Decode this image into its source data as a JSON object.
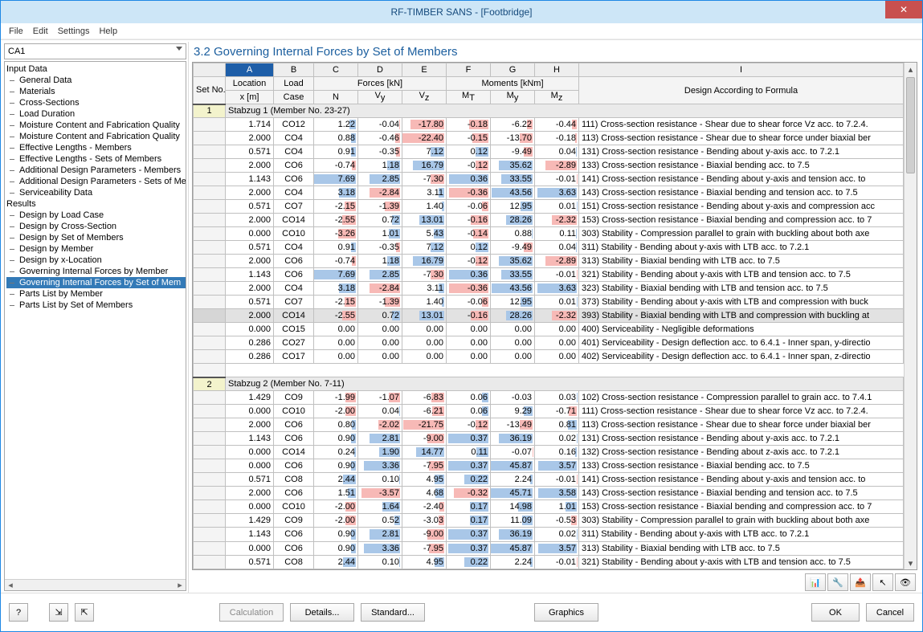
{
  "window": {
    "title": "RF-TIMBER SANS - [Footbridge]"
  },
  "menubar": {
    "file": "File",
    "edit": "Edit",
    "settings": "Settings",
    "help": "Help"
  },
  "left": {
    "combo": "CA1",
    "root1": "Input Data",
    "items1": [
      "General Data",
      "Materials",
      "Cross-Sections",
      "Load Duration",
      "Moisture Content and Fabrication Quality",
      "Moisture Content and Fabrication Quality",
      "Effective Lengths - Members",
      "Effective Lengths - Sets of Members",
      "Additional Design Parameters - Members",
      "Additional Design Parameters - Sets of Me",
      "Serviceability Data"
    ],
    "root2": "Results",
    "items2": [
      "Design by Load Case",
      "Design by Cross-Section",
      "Design by Set of Members",
      "Design by Member",
      "Design by x-Location",
      "Governing Internal Forces by Member",
      "Governing Internal Forces by Set of Mem",
      "Parts List by Member",
      "Parts List by Set of Members"
    ],
    "selectedIndex2": 6
  },
  "main": {
    "title": "3.2  Governing Internal Forces by Set of Members",
    "colLetters": [
      "A",
      "B",
      "C",
      "D",
      "E",
      "F",
      "G",
      "H",
      "I"
    ],
    "groupHeads": {
      "set": "Set\nNo.",
      "location": "Location",
      "load": "Load",
      "forces": "Forces [kN]",
      "moments": "Moments [kNm]",
      "design": "Design According to Formula",
      "x": "x [m]",
      "case": "Case",
      "N": "N",
      "Vy": "V_y",
      "Vz": "V_z",
      "MT": "M_T",
      "My": "M_y",
      "Mz": "M_z"
    },
    "groups": [
      {
        "setNo": "1",
        "label": "Stabzug 1 (Member No. 23-27)",
        "selectedRow": 14,
        "rows": [
          {
            "x": "1.714",
            "lc": "CO12",
            "N": "1.22",
            "Vy": "-0.04",
            "Vz": "-17.80",
            "MT": "-0.18",
            "My": "-6.22",
            "Mz": "-0.44",
            "d": "111) Cross-section resistance - Shear due to shear force Vz acc. to 7.2.4."
          },
          {
            "x": "2.000",
            "lc": "CO4",
            "N": "0.88",
            "Vy": "-0.46",
            "Vz": "-22.40",
            "MT": "-0.15",
            "My": "-13.70",
            "Mz": "-0.18",
            "d": "113) Cross-section resistance - Shear due to shear force under biaxial ber"
          },
          {
            "x": "0.571",
            "lc": "CO4",
            "N": "0.91",
            "Vy": "-0.35",
            "Vz": "7.12",
            "MT": "0.12",
            "My": "-9.49",
            "Mz": "0.04",
            "d": "131) Cross-section resistance - Bending about y-axis acc. to 7.2.1"
          },
          {
            "x": "2.000",
            "lc": "CO6",
            "N": "-0.74",
            "Vy": "1.18",
            "Vz": "16.79",
            "MT": "-0.12",
            "My": "35.62",
            "Mz": "-2.89",
            "d": "133) Cross-section resistance - Biaxial bending acc. to 7.5"
          },
          {
            "x": "1.143",
            "lc": "CO6",
            "N": "7.69",
            "Vy": "2.85",
            "Vz": "-7.30",
            "MT": "0.36",
            "My": "33.55",
            "Mz": "-0.01",
            "d": "141) Cross-section resistance - Bending about y-axis and tension acc. to"
          },
          {
            "x": "2.000",
            "lc": "CO4",
            "N": "3.18",
            "Vy": "-2.84",
            "Vz": "3.11",
            "MT": "-0.36",
            "My": "43.56",
            "Mz": "3.63",
            "d": "143) Cross-section resistance - Biaxial bending and tension acc. to 7.5"
          },
          {
            "x": "0.571",
            "lc": "CO7",
            "N": "-2.15",
            "Vy": "-1.39",
            "Vz": "1.40",
            "MT": "-0.06",
            "My": "12.95",
            "Mz": "0.01",
            "d": "151) Cross-section resistance - Bending about y-axis and compression acc"
          },
          {
            "x": "2.000",
            "lc": "CO14",
            "N": "-2.55",
            "Vy": "0.72",
            "Vz": "13.01",
            "MT": "-0.16",
            "My": "28.26",
            "Mz": "-2.32",
            "d": "153) Cross-section resistance - Biaxial bending and compression acc. to 7"
          },
          {
            "x": "0.000",
            "lc": "CO10",
            "N": "-3.26",
            "Vy": "1.01",
            "Vz": "5.43",
            "MT": "-0.14",
            "My": "0.88",
            "Mz": "0.11",
            "d": "303) Stability - Compression parallel to grain with buckling about both axe"
          },
          {
            "x": "0.571",
            "lc": "CO4",
            "N": "0.91",
            "Vy": "-0.35",
            "Vz": "7.12",
            "MT": "0.12",
            "My": "-9.49",
            "Mz": "0.04",
            "d": "311) Stability - Bending about y-axis with LTB acc. to 7.2.1"
          },
          {
            "x": "2.000",
            "lc": "CO6",
            "N": "-0.74",
            "Vy": "1.18",
            "Vz": "16.79",
            "MT": "-0.12",
            "My": "35.62",
            "Mz": "-2.89",
            "d": "313) Stability - Biaxial bending with LTB acc. to 7.5"
          },
          {
            "x": "1.143",
            "lc": "CO6",
            "N": "7.69",
            "Vy": "2.85",
            "Vz": "-7.30",
            "MT": "0.36",
            "My": "33.55",
            "Mz": "-0.01",
            "d": "321) Stability - Bending about y-axis with LTB and tension acc. to 7.5"
          },
          {
            "x": "2.000",
            "lc": "CO4",
            "N": "3.18",
            "Vy": "-2.84",
            "Vz": "3.11",
            "MT": "-0.36",
            "My": "43.56",
            "Mz": "3.63",
            "d": "323) Stability - Biaxial bending with LTB and tension acc. to 7.5"
          },
          {
            "x": "0.571",
            "lc": "CO7",
            "N": "-2.15",
            "Vy": "-1.39",
            "Vz": "1.40",
            "MT": "-0.06",
            "My": "12.95",
            "Mz": "0.01",
            "d": "373) Stability - Bending about y-axis with LTB and compression with buck"
          },
          {
            "x": "2.000",
            "lc": "CO14",
            "N": "-2.55",
            "Vy": "0.72",
            "Vz": "13.01",
            "MT": "-0.16",
            "My": "28.26",
            "Mz": "-2.32",
            "d": "393) Stability - Biaxial bending with LTB and compression with buckling at"
          },
          {
            "x": "0.000",
            "lc": "CO15",
            "N": "0.00",
            "Vy": "0.00",
            "Vz": "0.00",
            "MT": "0.00",
            "My": "0.00",
            "Mz": "0.00",
            "d": "400) Serviceability - Negligible deformations"
          },
          {
            "x": "0.286",
            "lc": "CO27",
            "N": "0.00",
            "Vy": "0.00",
            "Vz": "0.00",
            "MT": "0.00",
            "My": "0.00",
            "Mz": "0.00",
            "d": "401) Serviceability - Design deflection acc. to 6.4.1 - Inner span, y-directio"
          },
          {
            "x": "0.286",
            "lc": "CO17",
            "N": "0.00",
            "Vy": "0.00",
            "Vz": "0.00",
            "MT": "0.00",
            "My": "0.00",
            "Mz": "0.00",
            "d": "402) Serviceability - Design deflection acc. to 6.4.1 - Inner span, z-directio"
          }
        ]
      },
      {
        "setNo": "2",
        "label": "Stabzug 2 (Member No. 7-11)",
        "rows": [
          {
            "x": "1.429",
            "lc": "CO9",
            "N": "-1.99",
            "Vy": "-1.07",
            "Vz": "-6.83",
            "MT": "0.06",
            "My": "-0.03",
            "Mz": "0.03",
            "d": "102) Cross-section resistance - Compression parallel to grain acc. to 7.4.1"
          },
          {
            "x": "0.000",
            "lc": "CO10",
            "N": "-2.00",
            "Vy": "0.04",
            "Vz": "-6.21",
            "MT": "0.06",
            "My": "9.29",
            "Mz": "-0.71",
            "d": "111) Cross-section resistance - Shear due to shear force Vz acc. to 7.2.4."
          },
          {
            "x": "2.000",
            "lc": "CO6",
            "N": "0.80",
            "Vy": "-2.02",
            "Vz": "-21.75",
            "MT": "-0.12",
            "My": "-13.49",
            "Mz": "0.81",
            "d": "113) Cross-section resistance - Shear due to shear force under biaxial ber"
          },
          {
            "x": "1.143",
            "lc": "CO6",
            "N": "0.90",
            "Vy": "2.81",
            "Vz": "-9.00",
            "MT": "0.37",
            "My": "36.19",
            "Mz": "0.02",
            "d": "131) Cross-section resistance - Bending about y-axis acc. to 7.2.1"
          },
          {
            "x": "0.000",
            "lc": "CO14",
            "N": "0.24",
            "Vy": "1.90",
            "Vz": "14.77",
            "MT": "0.11",
            "My": "-0.07",
            "Mz": "0.16",
            "d": "132) Cross-section resistance - Bending about z-axis acc. to 7.2.1"
          },
          {
            "x": "0.000",
            "lc": "CO6",
            "N": "0.90",
            "Vy": "3.36",
            "Vz": "-7.95",
            "MT": "0.37",
            "My": "45.87",
            "Mz": "3.57",
            "d": "133) Cross-section resistance - Biaxial bending acc. to 7.5"
          },
          {
            "x": "0.571",
            "lc": "CO8",
            "N": "2.44",
            "Vy": "0.10",
            "Vz": "4.95",
            "MT": "0.22",
            "My": "2.24",
            "Mz": "-0.01",
            "d": "141) Cross-section resistance - Bending about y-axis and tension acc. to"
          },
          {
            "x": "2.000",
            "lc": "CO6",
            "N": "1.51",
            "Vy": "-3.57",
            "Vz": "4.68",
            "MT": "-0.32",
            "My": "45.71",
            "Mz": "3.58",
            "d": "143) Cross-section resistance - Biaxial bending and tension acc. to 7.5"
          },
          {
            "x": "0.000",
            "lc": "CO10",
            "N": "-2.00",
            "Vy": "1.64",
            "Vz": "-2.40",
            "MT": "0.17",
            "My": "14.98",
            "Mz": "1.01",
            "d": "153) Cross-section resistance - Biaxial bending and compression acc. to 7"
          },
          {
            "x": "1.429",
            "lc": "CO9",
            "N": "-2.00",
            "Vy": "0.52",
            "Vz": "-3.03",
            "MT": "0.17",
            "My": "11.09",
            "Mz": "-0.53",
            "d": "303) Stability - Compression parallel to grain with buckling about both axe"
          },
          {
            "x": "1.143",
            "lc": "CO6",
            "N": "0.90",
            "Vy": "2.81",
            "Vz": "-9.00",
            "MT": "0.37",
            "My": "36.19",
            "Mz": "0.02",
            "d": "311) Stability - Bending about y-axis with LTB acc. to 7.2.1"
          },
          {
            "x": "0.000",
            "lc": "CO6",
            "N": "0.90",
            "Vy": "3.36",
            "Vz": "-7.95",
            "MT": "0.37",
            "My": "45.87",
            "Mz": "3.57",
            "d": "313) Stability - Biaxial bending with LTB acc. to 7.5"
          },
          {
            "x": "0.571",
            "lc": "CO8",
            "N": "2.44",
            "Vy": "0.10",
            "Vz": "4.95",
            "MT": "0.22",
            "My": "2.24",
            "Mz": "-0.01",
            "d": "321) Stability - Bending about y-axis with LTB and tension acc. to 7.5"
          }
        ]
      }
    ]
  },
  "iconbar": [
    "chart-icon",
    "member-icon",
    "export-icon",
    "pick-icon",
    "eye-icon"
  ],
  "buttons": {
    "help": "?",
    "copy": "⇲",
    "paste": "⇱",
    "calc": "Calculation",
    "details": "Details...",
    "standard": "Standard...",
    "graphics": "Graphics",
    "ok": "OK",
    "cancel": "Cancel"
  },
  "maxScale": {
    "N": 8,
    "Vy": 4,
    "Vz": 23,
    "MT": 0.4,
    "My": 46,
    "Mz": 4
  }
}
